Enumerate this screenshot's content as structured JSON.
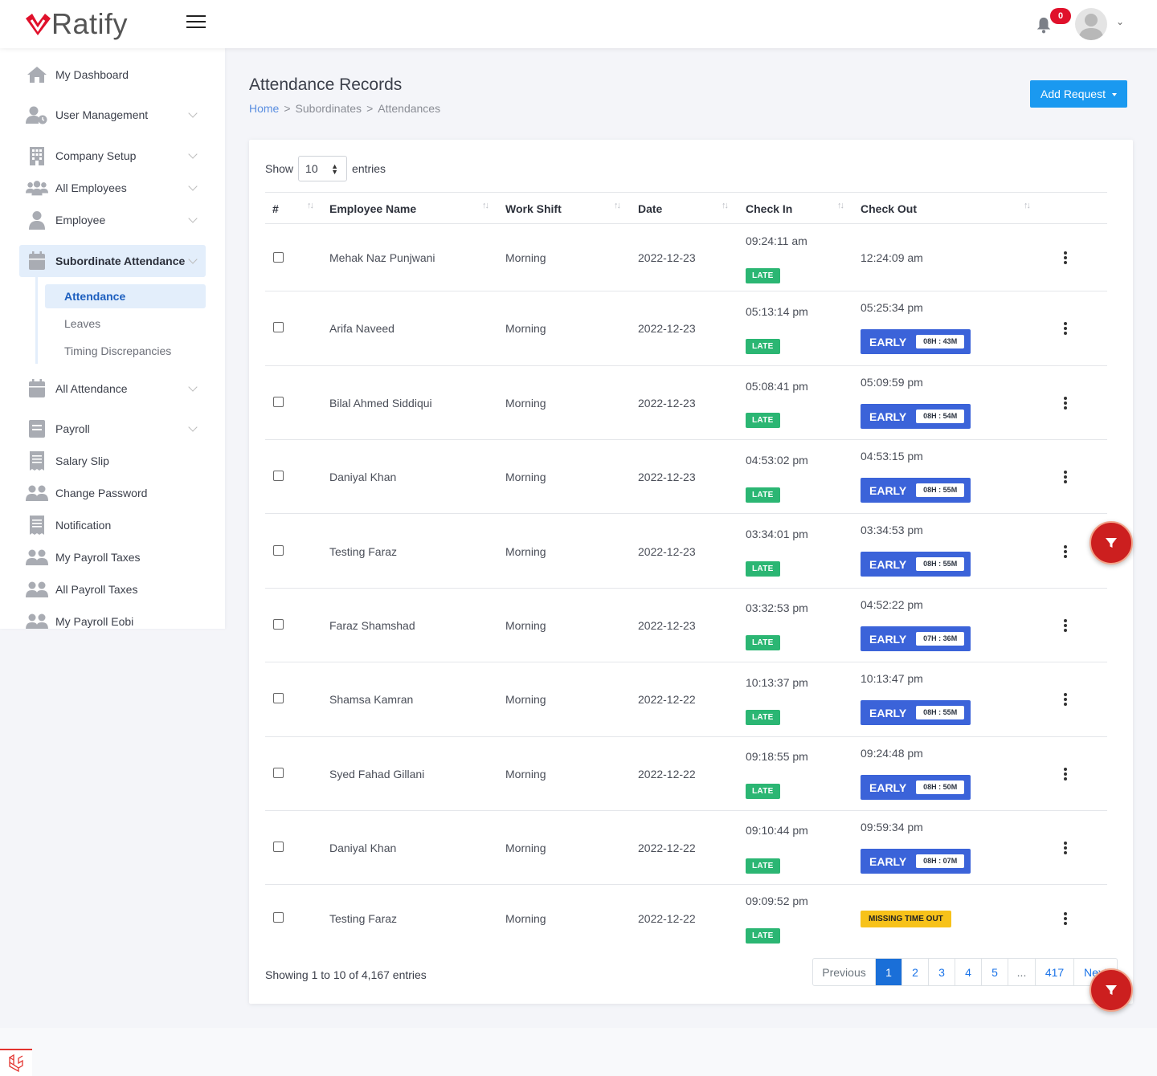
{
  "brand": {
    "name": "Ratify",
    "accent": "#e0112b"
  },
  "header": {
    "notification_count": "0"
  },
  "sidebar": {
    "items": [
      {
        "label": "My Dashboard",
        "icon": "home-icon"
      },
      {
        "label": "User Management",
        "icon": "user-clock-icon"
      },
      {
        "label": "Company Setup",
        "icon": "building-icon"
      },
      {
        "label": "All Employees",
        "icon": "users-icon"
      },
      {
        "label": "Employee",
        "icon": "user-icon"
      },
      {
        "label": "Subordinate Attendance",
        "icon": "calendar-icon"
      },
      {
        "label": "All Attendance",
        "icon": "calendar-icon"
      },
      {
        "label": "Payroll",
        "icon": "document-icon"
      },
      {
        "label": "Salary Slip",
        "icon": "receipt-icon"
      },
      {
        "label": "Change Password",
        "icon": "users-icon"
      },
      {
        "label": "Notification",
        "icon": "receipt-icon"
      },
      {
        "label": "My Payroll Taxes",
        "icon": "users-icon"
      },
      {
        "label": "All Payroll Taxes",
        "icon": "users-icon"
      },
      {
        "label": "My Payroll Eobi",
        "icon": "users-icon"
      }
    ],
    "sub_items": [
      {
        "label": "Attendance"
      },
      {
        "label": "Leaves"
      },
      {
        "label": "Timing Discrepancies"
      }
    ]
  },
  "page": {
    "title": "Attendance Records",
    "breadcrumb": {
      "home": "Home",
      "sep1": ">",
      "level2": "Subordinates",
      "sep2": ">",
      "level3": "Attendances"
    },
    "add_button": "Add Request"
  },
  "table": {
    "show_label": "Show",
    "entries_label": "entries",
    "page_size": "10",
    "columns": {
      "num": "#",
      "name": "Employee Name",
      "shift": "Work Shift",
      "date": "Date",
      "check_in": "Check In",
      "check_out": "Check Out"
    },
    "rows": [
      {
        "name": "Mehak Naz Punjwani",
        "shift": "Morning",
        "date": "2022-12-23",
        "check_in": "09:24:11 am",
        "in_status": "LATE",
        "check_out": "12:24:09 am",
        "out_status": "",
        "duration": ""
      },
      {
        "name": "Arifa Naveed",
        "shift": "Morning",
        "date": "2022-12-23",
        "check_in": "05:13:14 pm",
        "in_status": "LATE",
        "check_out": "05:25:34 pm",
        "out_status": "EARLY",
        "duration": "08H : 43M"
      },
      {
        "name": "Bilal Ahmed Siddiqui",
        "shift": "Morning",
        "date": "2022-12-23",
        "check_in": "05:08:41 pm",
        "in_status": "LATE",
        "check_out": "05:09:59 pm",
        "out_status": "EARLY",
        "duration": "08H : 54M"
      },
      {
        "name": "Daniyal Khan",
        "shift": "Morning",
        "date": "2022-12-23",
        "check_in": "04:53:02 pm",
        "in_status": "LATE",
        "check_out": "04:53:15 pm",
        "out_status": "EARLY",
        "duration": "08H : 55M"
      },
      {
        "name": "Testing Faraz",
        "shift": "Morning",
        "date": "2022-12-23",
        "check_in": "03:34:01 pm",
        "in_status": "LATE",
        "check_out": "03:34:53 pm",
        "out_status": "EARLY",
        "duration": "08H : 55M"
      },
      {
        "name": "Faraz Shamshad",
        "shift": "Morning",
        "date": "2022-12-23",
        "check_in": "03:32:53 pm",
        "in_status": "LATE",
        "check_out": "04:52:22 pm",
        "out_status": "EARLY",
        "duration": "07H : 36M"
      },
      {
        "name": "Shamsa Kamran",
        "shift": "Morning",
        "date": "2022-12-22",
        "check_in": "10:13:37 pm",
        "in_status": "LATE",
        "check_out": "10:13:47 pm",
        "out_status": "EARLY",
        "duration": "08H : 55M"
      },
      {
        "name": "Syed Fahad Gillani",
        "shift": "Morning",
        "date": "2022-12-22",
        "check_in": "09:18:55 pm",
        "in_status": "LATE",
        "check_out": "09:24:48 pm",
        "out_status": "EARLY",
        "duration": "08H : 50M"
      },
      {
        "name": "Daniyal Khan",
        "shift": "Morning",
        "date": "2022-12-22",
        "check_in": "09:10:44 pm",
        "in_status": "LATE",
        "check_out": "09:59:34 pm",
        "out_status": "EARLY",
        "duration": "08H : 07M"
      },
      {
        "name": "Testing Faraz",
        "shift": "Morning",
        "date": "2022-12-22",
        "check_in": "09:09:52 pm",
        "in_status": "LATE",
        "check_out": "",
        "out_status": "MISSING TIME OUT",
        "duration": ""
      }
    ],
    "info": "Showing 1 to 10 of 4,167 entries"
  },
  "pagination": {
    "previous": "Previous",
    "pages": [
      "1",
      "2",
      "3",
      "4",
      "5",
      "...",
      "417"
    ],
    "next": "Next"
  },
  "colors": {
    "late": "#2bb673",
    "early": "#3b63d9",
    "missing": "#f7c21a",
    "primary": "#1a99f0",
    "fab": "#cc1f1f"
  }
}
